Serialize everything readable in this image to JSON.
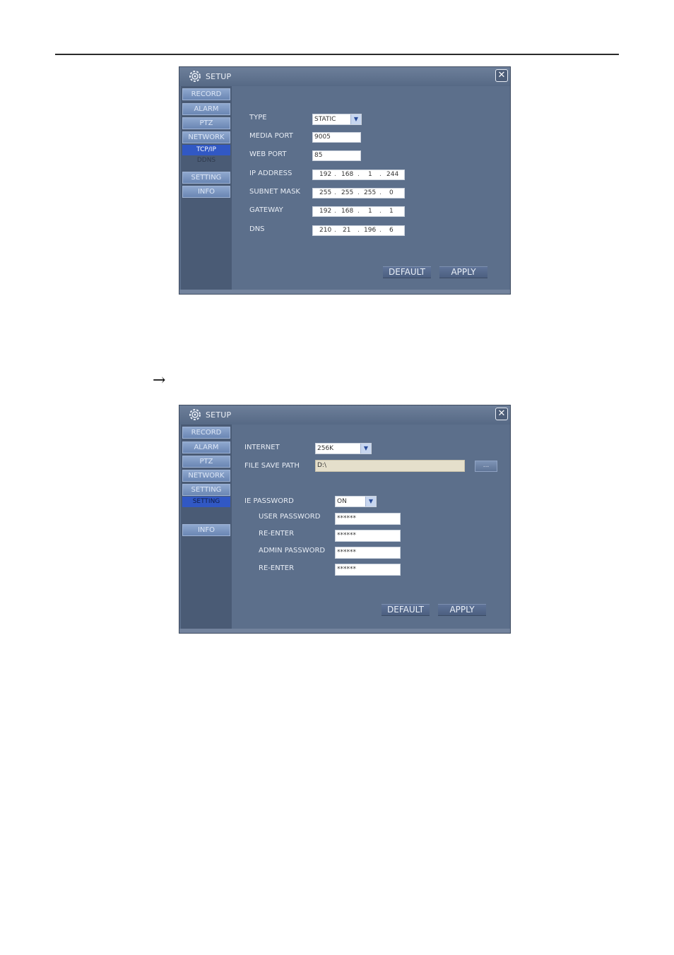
{
  "window1": {
    "title": "SETUP",
    "nav": {
      "record": "RECORD",
      "alarm": "ALARM",
      "ptz": "PTZ",
      "network": "NETWORK",
      "tcpip": "TCP/IP",
      "ddns": "DDNS",
      "setting": "SETTING",
      "info": "INFO"
    },
    "fields": {
      "type_label": "TYPE",
      "type_value": "STATIC",
      "media_port_label": "MEDIA PORT",
      "media_port_value": "9005",
      "web_port_label": "WEB PORT",
      "web_port_value": "85",
      "ip_label": "IP ADDRESS",
      "ip": [
        "192",
        "168",
        "1",
        "244"
      ],
      "subnet_label": "SUBNET MASK",
      "subnet": [
        "255",
        "255",
        "255",
        "0"
      ],
      "gateway_label": "GATEWAY",
      "gateway": [
        "192",
        "168",
        "1",
        "1"
      ],
      "dns_label": "DNS",
      "dns": [
        "210",
        "21",
        "196",
        "6"
      ]
    },
    "buttons": {
      "default": "DEFAULT",
      "apply": "APPLY"
    }
  },
  "arrow": "→",
  "window2": {
    "title": "SETUP",
    "nav": {
      "record": "RECORD",
      "alarm": "ALARM",
      "ptz": "PTZ",
      "network": "NETWORK",
      "setting": "SETTING",
      "setting_sub": "SETTING",
      "info": "INFO"
    },
    "fields": {
      "internet_label": "INTERNET",
      "internet_value": "256K",
      "file_path_label": "FILE SAVE PATH",
      "file_path_value": "D:\\",
      "browse": "...",
      "ie_password_label": "IE PASSWORD",
      "ie_password_value": "ON",
      "user_password_label": "USER PASSWORD",
      "user_password_value": "******",
      "reenter1_label": "RE-ENTER",
      "reenter1_value": "******",
      "admin_password_label": "ADMIN PASSWORD",
      "admin_password_value": "******",
      "reenter2_label": "RE-ENTER",
      "reenter2_value": "******"
    },
    "buttons": {
      "default": "DEFAULT",
      "apply": "APPLY"
    }
  }
}
